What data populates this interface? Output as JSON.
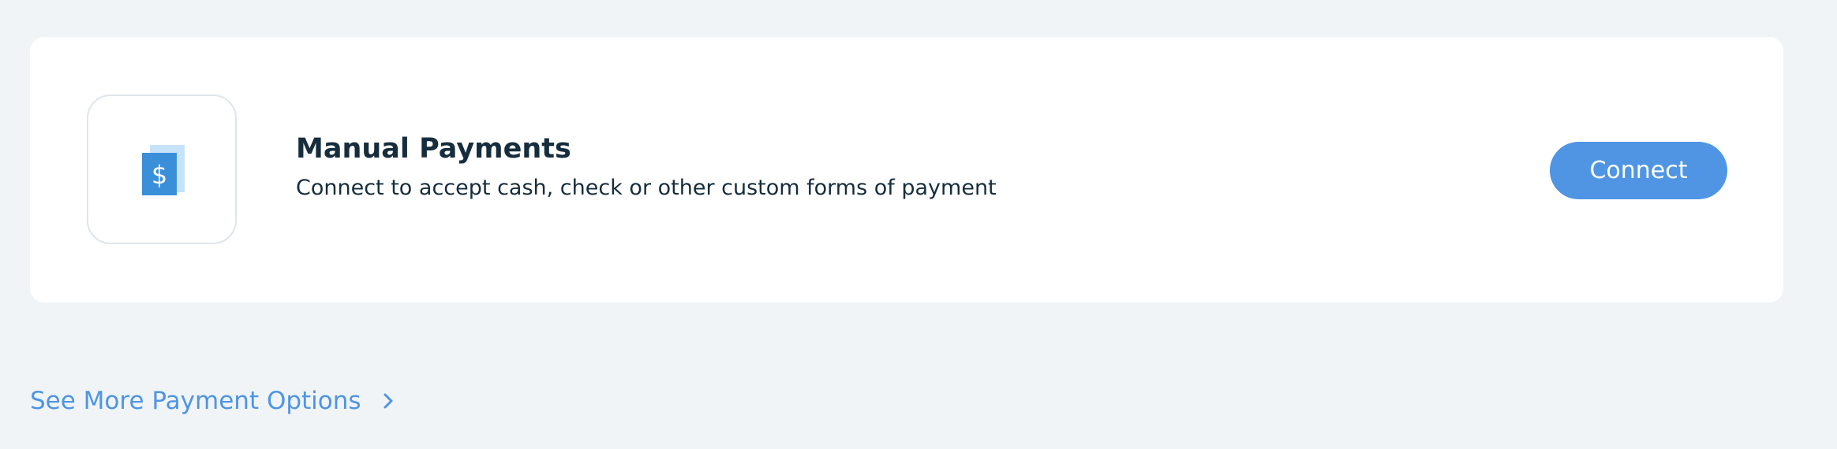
{
  "card": {
    "icon": "dollar-bill-icon",
    "title": "Manual Payments",
    "description": "Connect to accept cash, check or other custom forms of payment",
    "connect_label": "Connect"
  },
  "footer": {
    "see_more_label": "See More Payment Options",
    "chevron_icon": "chevron-right-icon"
  },
  "colors": {
    "background": "#f0f4f7",
    "card": "#ffffff",
    "accent": "#4f95e3",
    "text": "#162d3d",
    "icon_primary": "#3b8fd9",
    "icon_secondary": "#c7e2fb"
  }
}
